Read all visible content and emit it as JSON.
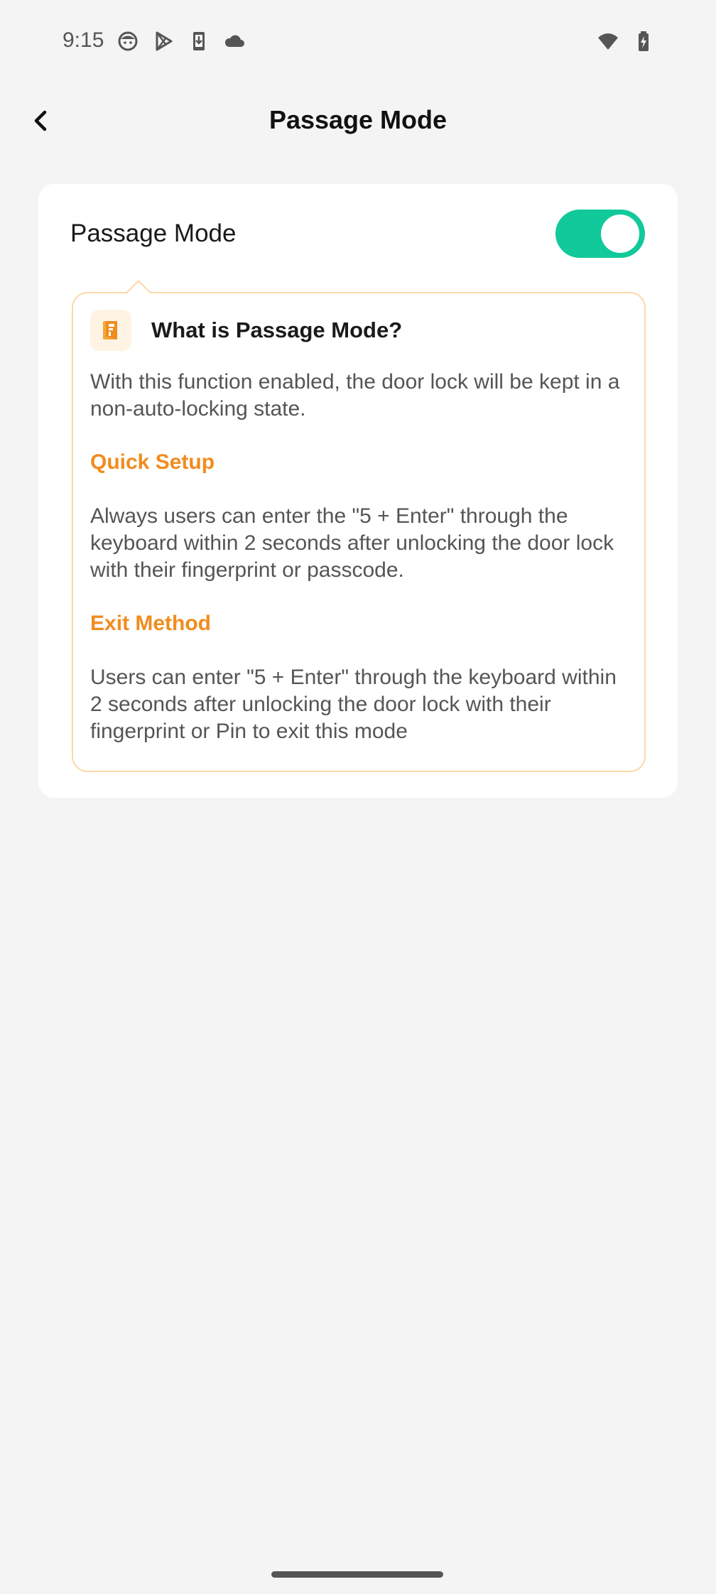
{
  "status_bar": {
    "time": "9:15",
    "left_icons": [
      "face-icon",
      "play-store-icon",
      "download-icon",
      "cloud-icon"
    ],
    "right_icons": [
      "wifi-icon",
      "battery-charging-icon"
    ]
  },
  "app_bar": {
    "title": "Passage Mode",
    "back_icon": "chevron-left-icon"
  },
  "setting": {
    "label": "Passage Mode",
    "toggle_on": true,
    "toggle_color": "#12c99b"
  },
  "info": {
    "icon": "door-icon",
    "title": "What is Passage Mode?",
    "description": "With this function enabled, the door lock will be kept in a non-auto-locking state.",
    "quick_setup_title": "Quick Setup",
    "quick_setup_text": "Always users can enter the \"5 + Enter\" through the keyboard within 2 seconds after unlocking the door lock with their fingerprint or passcode.",
    "exit_method_title": "Exit Method",
    "exit_method_text": "Users can enter \"5 + Enter\" through the keyboard within 2 seconds after unlocking the door lock with their fingerprint or Pin to exit this mode",
    "accent_color": "#f08c1e",
    "border_color": "#fbd8a8"
  }
}
